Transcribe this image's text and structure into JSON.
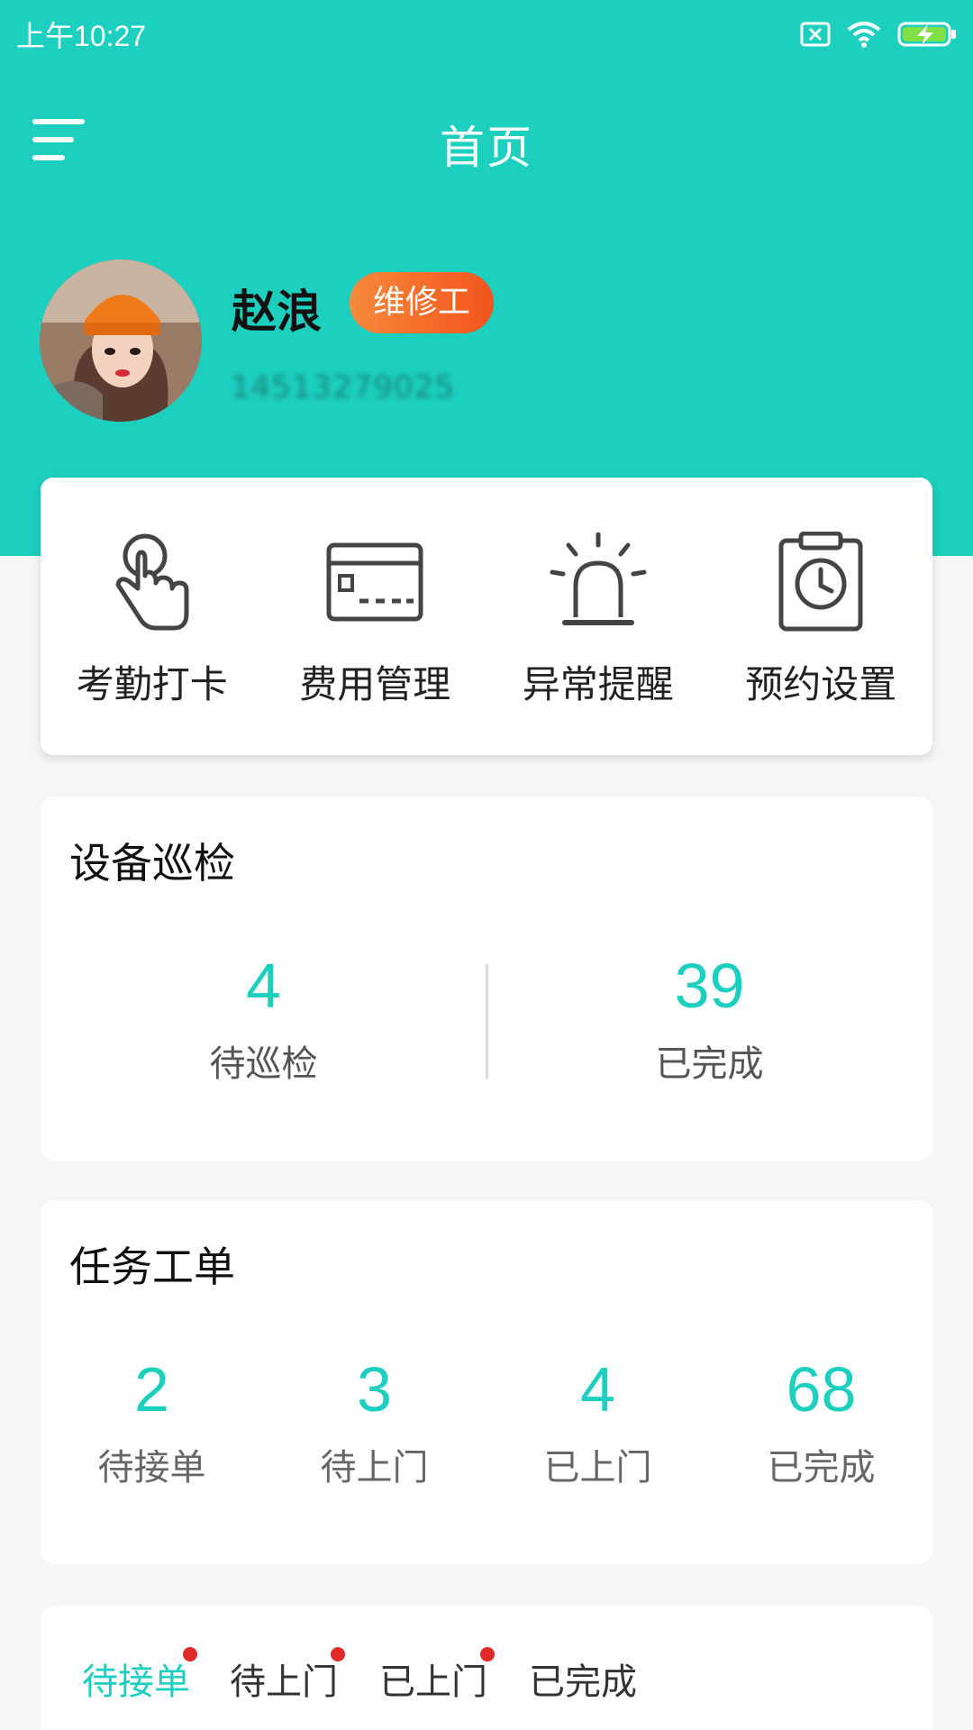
{
  "status_bar": {
    "time": "上午10:27"
  },
  "header": {
    "title": "首页"
  },
  "profile": {
    "name": "赵浪",
    "role": "维修工",
    "phone": "14513279025"
  },
  "quick_actions": [
    {
      "label": "考勤打卡",
      "icon": "hand-pointer-icon"
    },
    {
      "label": "费用管理",
      "icon": "card-icon"
    },
    {
      "label": "异常提醒",
      "icon": "alarm-icon"
    },
    {
      "label": "预约设置",
      "icon": "clipboard-clock-icon"
    }
  ],
  "inspection": {
    "title": "设备巡检",
    "stats": [
      {
        "value": "4",
        "label": "待巡检"
      },
      {
        "value": "39",
        "label": "已完成"
      }
    ]
  },
  "tasks": {
    "title": "任务工单",
    "stats": [
      {
        "value": "2",
        "label": "待接单"
      },
      {
        "value": "3",
        "label": "待上门"
      },
      {
        "value": "4",
        "label": "已上门"
      },
      {
        "value": "68",
        "label": "已完成"
      }
    ]
  },
  "tabs": [
    {
      "label": "待接单",
      "active": true,
      "dot": true
    },
    {
      "label": "待上门",
      "active": false,
      "dot": true
    },
    {
      "label": "已上门",
      "active": false,
      "dot": true
    },
    {
      "label": "已完成",
      "active": false,
      "dot": false
    }
  ],
  "colors": {
    "accent": "#1ccfbf",
    "badge": "#f2531d",
    "dot": "#e02a2a"
  }
}
